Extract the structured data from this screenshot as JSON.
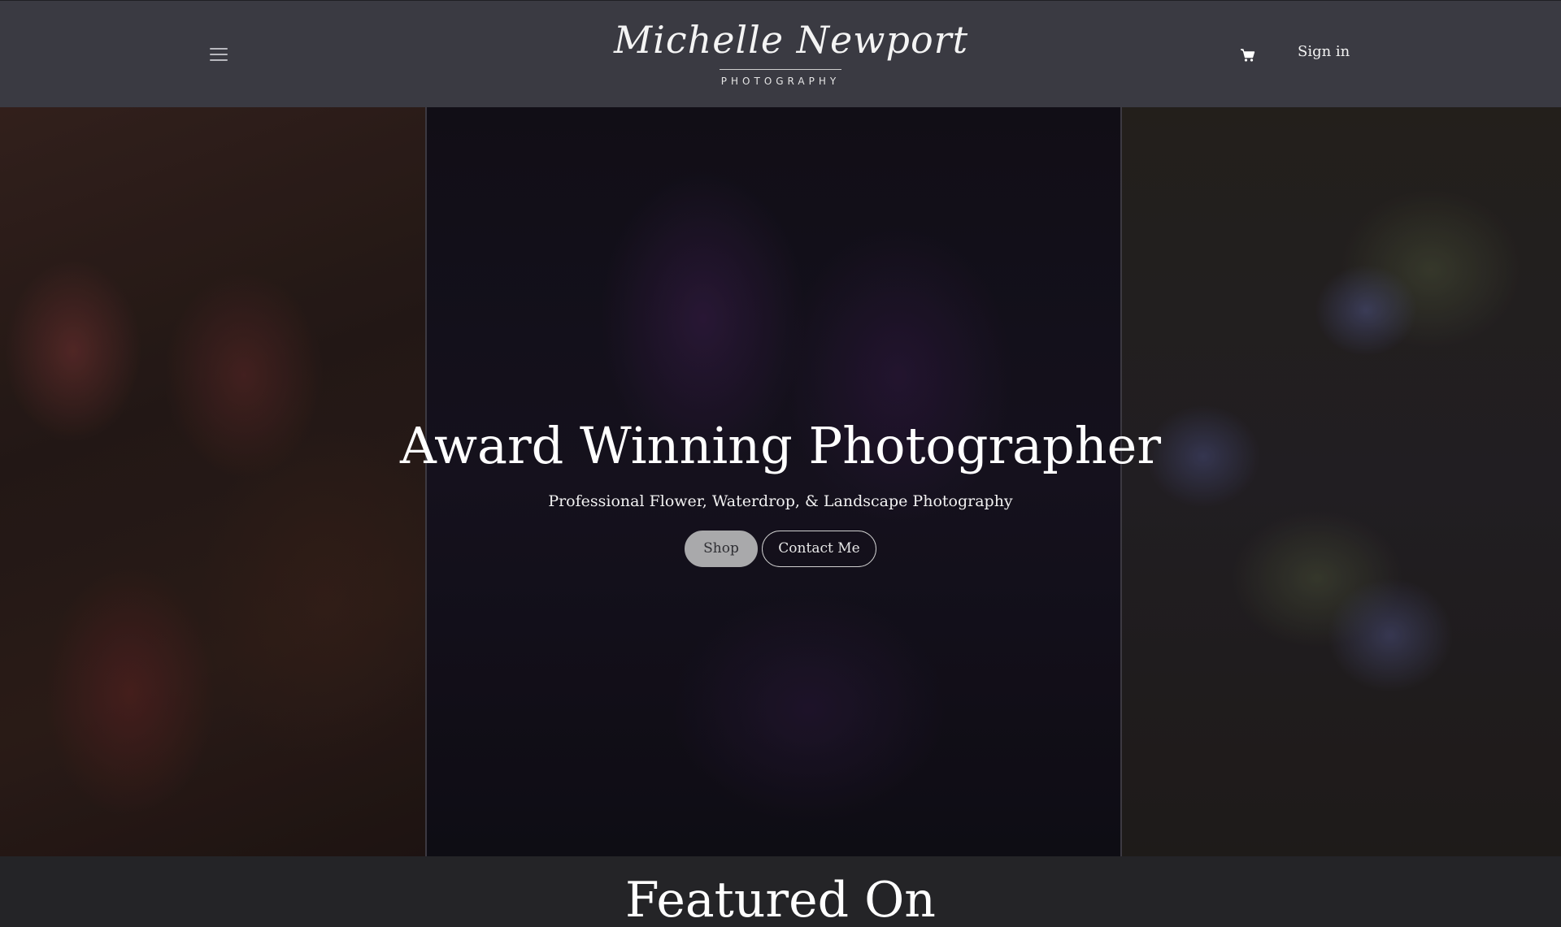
{
  "header": {
    "logo_script": "Michelle Newport",
    "logo_subtitle": "PHOTOGRAPHY",
    "menu_icon": "hamburger-menu-icon",
    "cart_icon": "shopping-cart-icon",
    "signin_label": "Sign in",
    "background": "#3a3a42"
  },
  "hero": {
    "title": "Award Winning Photographer",
    "subtitle": "Professional Flower, Waterdrop, & Landscape Photography",
    "shop_label": "Shop",
    "contact_label": "Contact Me",
    "panels": [
      "red-flower-photo",
      "purple-calla-lily-photo",
      "blue-hydrangea-photo"
    ]
  },
  "featured": {
    "title": "Featured On"
  },
  "colors": {
    "header_bg": "#3a3a42",
    "page_bg": "#242427",
    "shop_button_bg": "#a9a9ab",
    "text_light": "#ffffff"
  }
}
